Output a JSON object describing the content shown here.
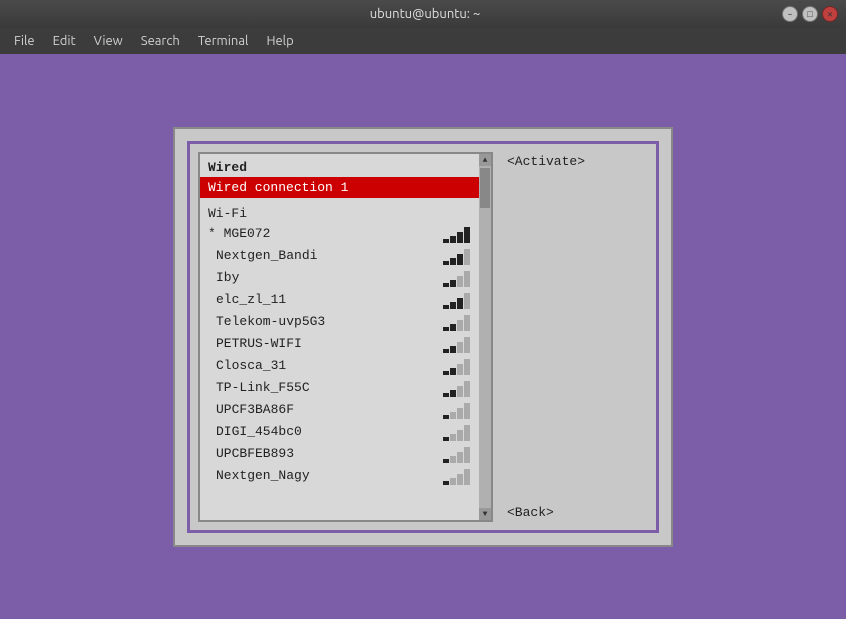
{
  "titlebar": {
    "title": "ubuntu@ubuntu: ~",
    "minimize_label": "–",
    "maximize_label": "□",
    "close_label": "✕"
  },
  "menubar": {
    "items": [
      {
        "label": "File",
        "id": "file"
      },
      {
        "label": "Edit",
        "id": "edit"
      },
      {
        "label": "View",
        "id": "view"
      },
      {
        "label": "Search",
        "id": "search"
      },
      {
        "label": "Terminal",
        "id": "terminal"
      },
      {
        "label": "Help",
        "id": "help"
      }
    ]
  },
  "dialog": {
    "activate_button": "<Activate>",
    "back_button": "<Back>",
    "wired_section": "Wired",
    "wired_connection": "Wired connection 1",
    "wifi_section": "Wi-Fi",
    "networks": [
      {
        "name": "* MGE072",
        "signal": 4,
        "starred": true
      },
      {
        "name": "Nextgen_Bandi",
        "signal": 3,
        "starred": false
      },
      {
        "name": "Iby",
        "signal": 2,
        "starred": false
      },
      {
        "name": "elc_zl_11",
        "signal": 3,
        "starred": false
      },
      {
        "name": "Telekom-uvp5G3",
        "signal": 2,
        "starred": false
      },
      {
        "name": "PETRUS-WIFI",
        "signal": 2,
        "starred": false
      },
      {
        "name": "Closca_31",
        "signal": 2,
        "starred": false
      },
      {
        "name": "TP-Link_F55C",
        "signal": 2,
        "starred": false
      },
      {
        "name": "UPCF3BA86F",
        "signal": 1,
        "starred": false
      },
      {
        "name": "DIGI_454bc0",
        "signal": 1,
        "starred": false
      },
      {
        "name": "UPCBFEB893",
        "signal": 1,
        "starred": false
      },
      {
        "name": "Nextgen_Nagy",
        "signal": 1,
        "starred": false
      }
    ]
  }
}
